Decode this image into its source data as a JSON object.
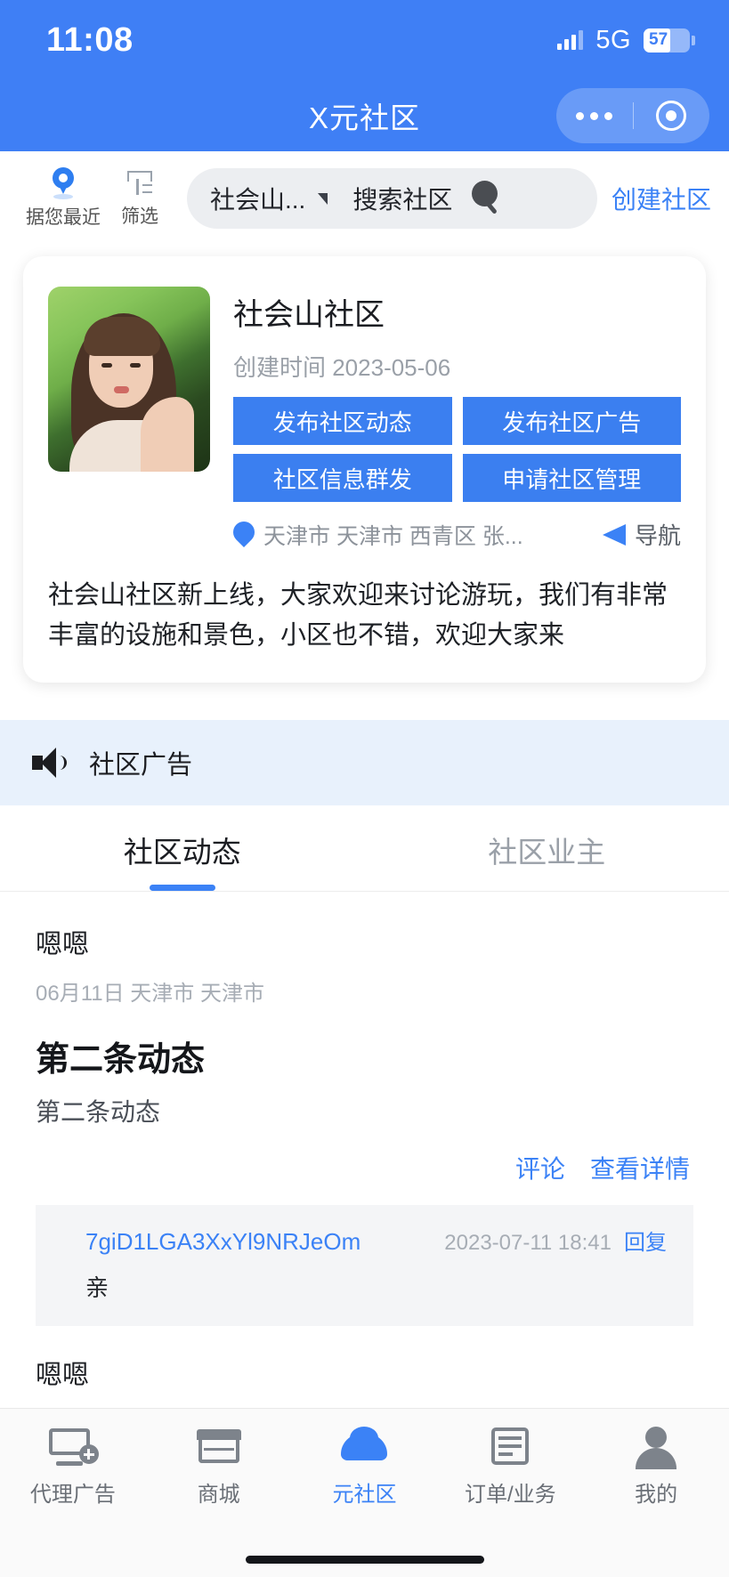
{
  "status_bar": {
    "time": "11:08",
    "network": "5G",
    "battery_level": "57"
  },
  "nav": {
    "title": "X元社区"
  },
  "search_row": {
    "nearby_label": "据您最近",
    "filter_label": "筛选",
    "selected_community": "社会山...",
    "search_placeholder": "搜索社区",
    "create_label": "创建社区"
  },
  "community_card": {
    "name": "社会山社区",
    "created_label": "创建时间 2023-05-06",
    "buttons": [
      "发布社区动态",
      "发布社区广告",
      "社区信息群发",
      "申请社区管理"
    ],
    "address": "天津市 天津市 西青区 张...",
    "navigate_label": "导航",
    "description": "社会山社区新上线，大家欢迎来讨论游玩，我们有非常丰富的设施和景色，小区也不错，欢迎大家来"
  },
  "ad_bar": {
    "label": "社区广告"
  },
  "tabs": [
    {
      "label": "社区动态",
      "active": true
    },
    {
      "label": "社区业主",
      "active": false
    }
  ],
  "feed": {
    "posts": [
      {
        "author": "嗯嗯",
        "meta": "06月11日 天津市 天津市",
        "title": "第二条动态",
        "body": "第二条动态",
        "actions": {
          "comment": "评论",
          "detail": "查看详情"
        },
        "comment": {
          "user": "7giD1LGA3XxYl9NRJeOm",
          "time": "2023-07-11 18:41",
          "reply_label": "回复",
          "text": "亲"
        }
      },
      {
        "author": "嗯嗯"
      }
    ]
  },
  "tabbar": [
    {
      "label": "代理广告",
      "active": false
    },
    {
      "label": "商城",
      "active": false
    },
    {
      "label": "元社区",
      "active": true
    },
    {
      "label": "订单/业务",
      "active": false
    },
    {
      "label": "我的",
      "active": false
    }
  ],
  "colors": {
    "primary": "#3f7ff5",
    "button_blue": "#3b7ff0",
    "link_blue": "#3b82f6",
    "ad_bg": "#e8f1fc"
  }
}
